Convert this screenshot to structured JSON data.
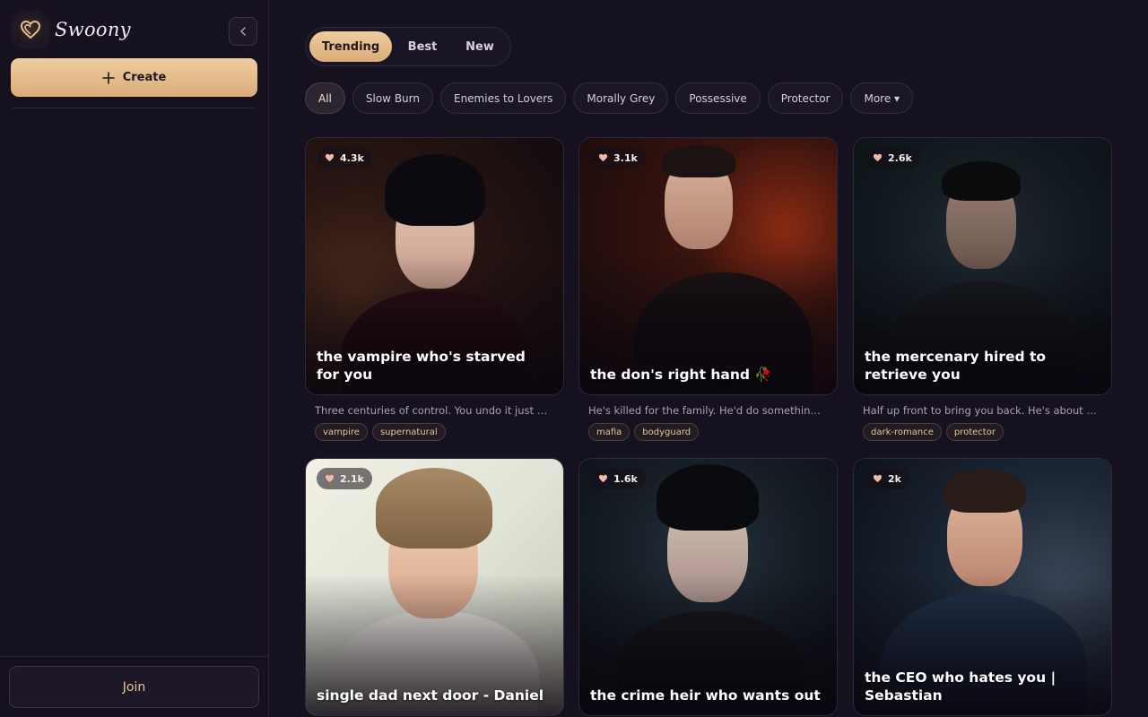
{
  "brand": {
    "name": "Swoony",
    "logo_icon": "heart-logo-icon"
  },
  "sidebar": {
    "create_label": "Create",
    "join_label": "Join",
    "collapse_icon": "chevron-left-icon"
  },
  "tabs": [
    {
      "label": "Trending",
      "active": true
    },
    {
      "label": "Best",
      "active": false
    },
    {
      "label": "New",
      "active": false
    }
  ],
  "filters": [
    {
      "label": "All",
      "active": true
    },
    {
      "label": "Slow Burn"
    },
    {
      "label": "Enemies to Lovers"
    },
    {
      "label": "Morally Grey"
    },
    {
      "label": "Possessive"
    },
    {
      "label": "Protector"
    },
    {
      "label": "More ▾"
    }
  ],
  "cards": [
    {
      "likes": "4.3k",
      "title": "the vampire who's starved for you",
      "description": "Three centuries of control. You undo it just by breathing.",
      "tags": [
        "vampire",
        "supernatural"
      ]
    },
    {
      "likes": "3.1k",
      "title": "the don's right hand 🥀",
      "description": "He's killed for the family. He'd do something worse for you.",
      "tags": [
        "mafia",
        "bodyguard"
      ]
    },
    {
      "likes": "2.6k",
      "title": "the mercenary hired to retrieve you",
      "description": "Half up front to bring you back. He's about to refuse the rest.",
      "tags": [
        "dark-romance",
        "protector"
      ]
    },
    {
      "likes": "2.1k",
      "title": "single dad next door - Daniel",
      "description": "",
      "tags": []
    },
    {
      "likes": "1.6k",
      "title": "the crime heir who wants out",
      "description": "",
      "tags": []
    },
    {
      "likes": "2k",
      "title": "the CEO who hates you | Sebastian",
      "description": "",
      "tags": []
    }
  ],
  "colors": {
    "accent": "#e3bb88",
    "background": "#15111f"
  }
}
